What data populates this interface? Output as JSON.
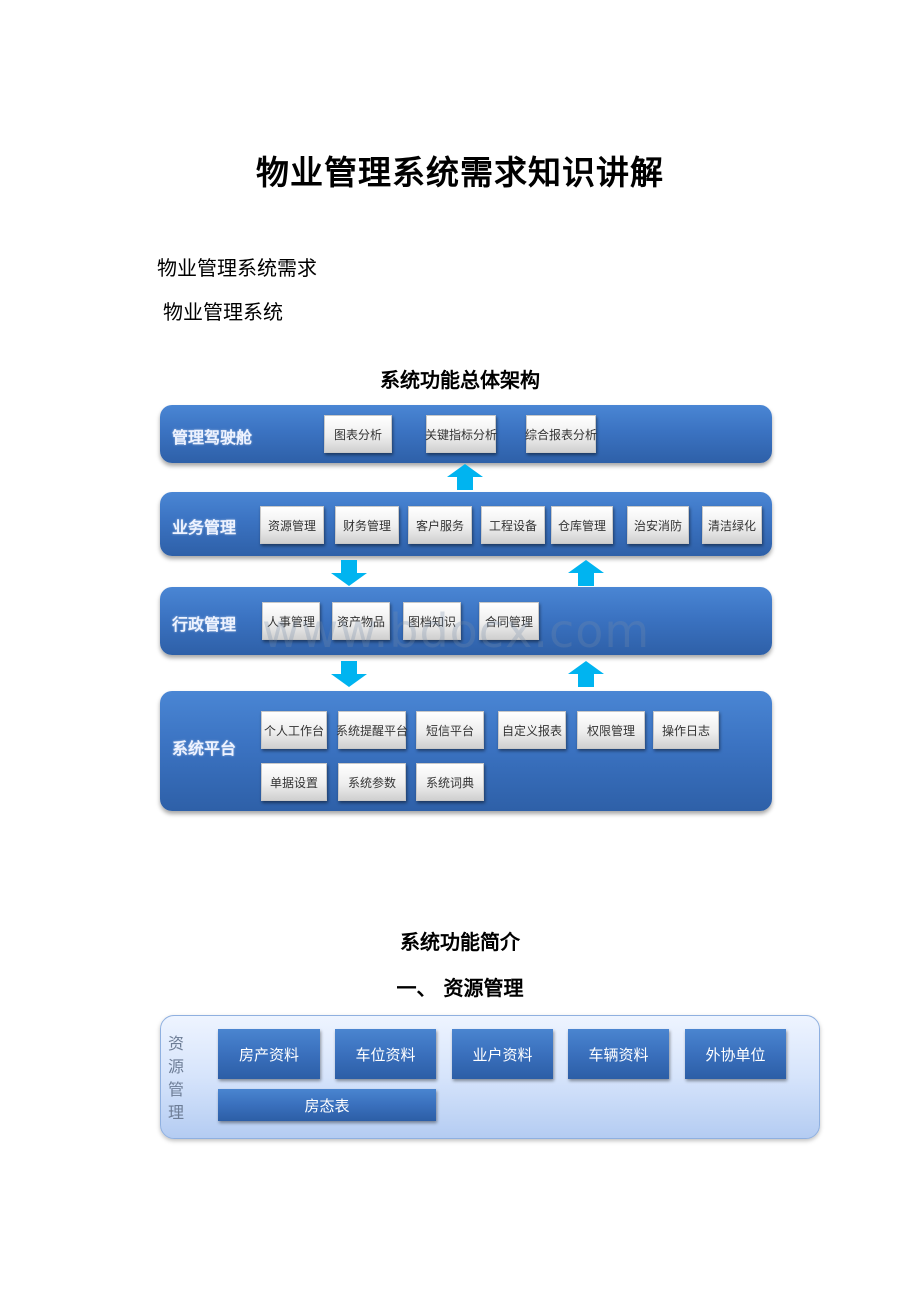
{
  "document": {
    "title": "物业管理系统需求知识讲解",
    "subtitle_1": "物业管理系统需求",
    "subtitle_2": "物业管理系统",
    "architecture_title": "系统功能总体架构",
    "watermark": "www.bdocx.com",
    "intro_title": "系统功能简介",
    "section_1_heading": "一、 资源管理"
  },
  "architecture": {
    "layers": [
      {
        "label": "管理驾驶舱",
        "modules": [
          "图表分析",
          "关键指标分析",
          "综合报表分析"
        ]
      },
      {
        "label": "业务管理",
        "modules": [
          "资源管理",
          "财务管理",
          "客户服务",
          "工程设备",
          "仓库管理",
          "治安消防",
          "清洁绿化"
        ]
      },
      {
        "label": "行政管理",
        "modules": [
          "人事管理",
          "资产物品",
          "图档知识",
          "合同管理"
        ]
      },
      {
        "label": "系统平台",
        "modules": [
          "个人工作台",
          "系统提醒平台",
          "短信平台",
          "自定义报表",
          "权限管理",
          "操作日志",
          "单据设置",
          "系统参数",
          "系统词典"
        ]
      }
    ],
    "arrows": [
      {
        "direction": "up",
        "from": "业务管理",
        "to": "管理驾驶舱"
      },
      {
        "direction": "down",
        "from": "业务管理",
        "to": "行政管理"
      },
      {
        "direction": "up",
        "from": "行政管理",
        "to": "业务管理"
      },
      {
        "direction": "down",
        "from": "行政管理",
        "to": "系统平台"
      },
      {
        "direction": "up",
        "from": "系统平台",
        "to": "行政管理"
      }
    ],
    "colors": {
      "band": "#3b73c2",
      "arrow": "#00b4f0",
      "module_bg": "#eeeeee"
    }
  },
  "resource_management": {
    "label": "资源管理",
    "items": [
      "房产资料",
      "车位资料",
      "业户资料",
      "车辆资料",
      "外协单位",
      "房态表"
    ],
    "colors": {
      "panel": "#d6e4fb",
      "item": "#3a70bd"
    }
  }
}
